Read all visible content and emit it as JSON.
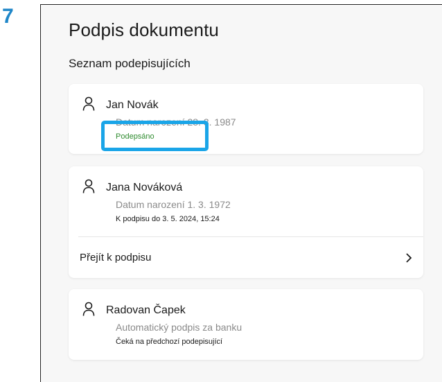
{
  "step": "7",
  "page": {
    "title": "Podpis dokumentu",
    "section_title": "Seznam podepisujících"
  },
  "signers": [
    {
      "name": "Jan Novák",
      "detail": "Datum narození 28. 3. 1987",
      "status": "Podepsáno"
    },
    {
      "name": "Jana Nováková",
      "detail": "Datum narození 1. 3. 1972",
      "status": "K podpisu do 3. 5. 2024, 15:24",
      "action_label": "Přejít k podpisu"
    },
    {
      "name": "Radovan Čapek",
      "detail": "Automatický podpis za banku",
      "status": "Čeká na předchozí podepisující"
    }
  ],
  "colors": {
    "step_number": "#1f86c8",
    "highlight": "#1aa5e8",
    "signed_status": "#2e8b2e",
    "background": "#f7f7f7"
  },
  "icons": {
    "person": "person-icon",
    "chevron": "chevron-right-icon"
  }
}
